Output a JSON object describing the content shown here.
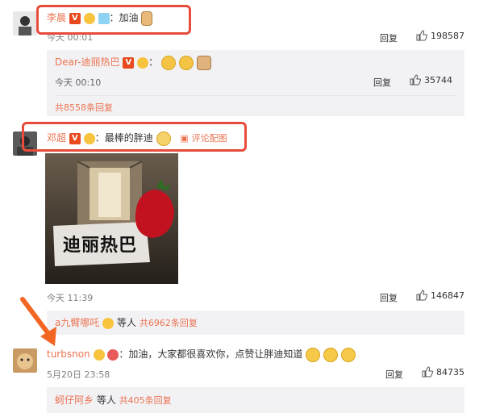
{
  "top_partial": "...",
  "comment1": {
    "author": "李晨",
    "colon": "：",
    "text": "加油",
    "time": "今天 00:01",
    "reply": "回复",
    "likes": "198587"
  },
  "reply1": {
    "author": "Dear-迪丽热巴",
    "time": "今天 00:10",
    "reply": "回复",
    "likes": "35744"
  },
  "reply1_more": "共8558条回复",
  "comment2": {
    "author": "邓超",
    "colon": "：",
    "text": "最棒的胖迪",
    "pic_link": "评论配图",
    "image_caption": "迪丽热巴",
    "time": "今天 11:39",
    "reply": "回复",
    "likes": "146847"
  },
  "reply2": {
    "author": "a九臂哪吒",
    "others": "等人",
    "more": "共6962条回复"
  },
  "comment3": {
    "author": "turbsnon",
    "colon": "：",
    "text": "加油，大家都很喜欢你，点赞让胖迪知道",
    "time": "5月20日 23:58",
    "reply": "回复",
    "likes": "84735"
  },
  "reply3": {
    "author": "蚵仔阿乡",
    "others": "等人",
    "more": "共405条回复"
  },
  "colors": {
    "name": "#eb7350",
    "highlight": "#e74c3c",
    "arrow": "#f26522"
  }
}
